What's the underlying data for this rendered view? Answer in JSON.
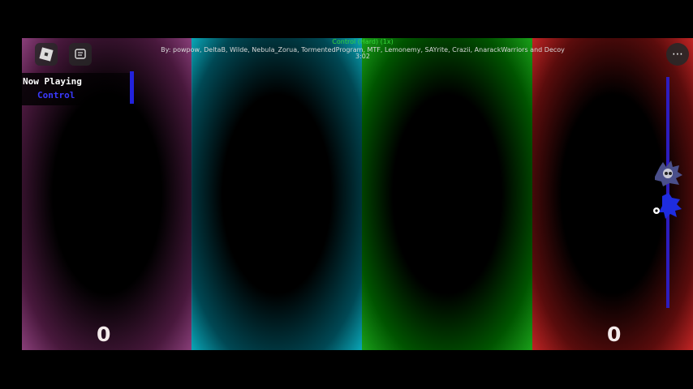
{
  "song": {
    "title": "Control (Hard) (1x)",
    "credits": "By: powpow, DeltaB, Wilde, Nebula_Zorua, TormentedProgram, MTF, Lemonemy, SAYrite, Crazii, AnarackWarriors and Decoy",
    "time": "3:02"
  },
  "now_playing": {
    "label": "Now Playing",
    "song": "Control"
  },
  "scores": {
    "left": "0",
    "right": "0"
  },
  "lanes": [
    {
      "name": "lane-1",
      "color": "#8a3f7a"
    },
    {
      "name": "lane-2",
      "color": "#0aa7b8"
    },
    {
      "name": "lane-3",
      "color": "#1aa01a"
    },
    {
      "name": "lane-4",
      "color": "#c02424"
    }
  ],
  "icons": {
    "roblox": "roblox-logo-icon",
    "chat": "chat-icon",
    "menu": "more-options-icon",
    "enemy": "enemy-character-icon",
    "player": "player-character-icon"
  }
}
